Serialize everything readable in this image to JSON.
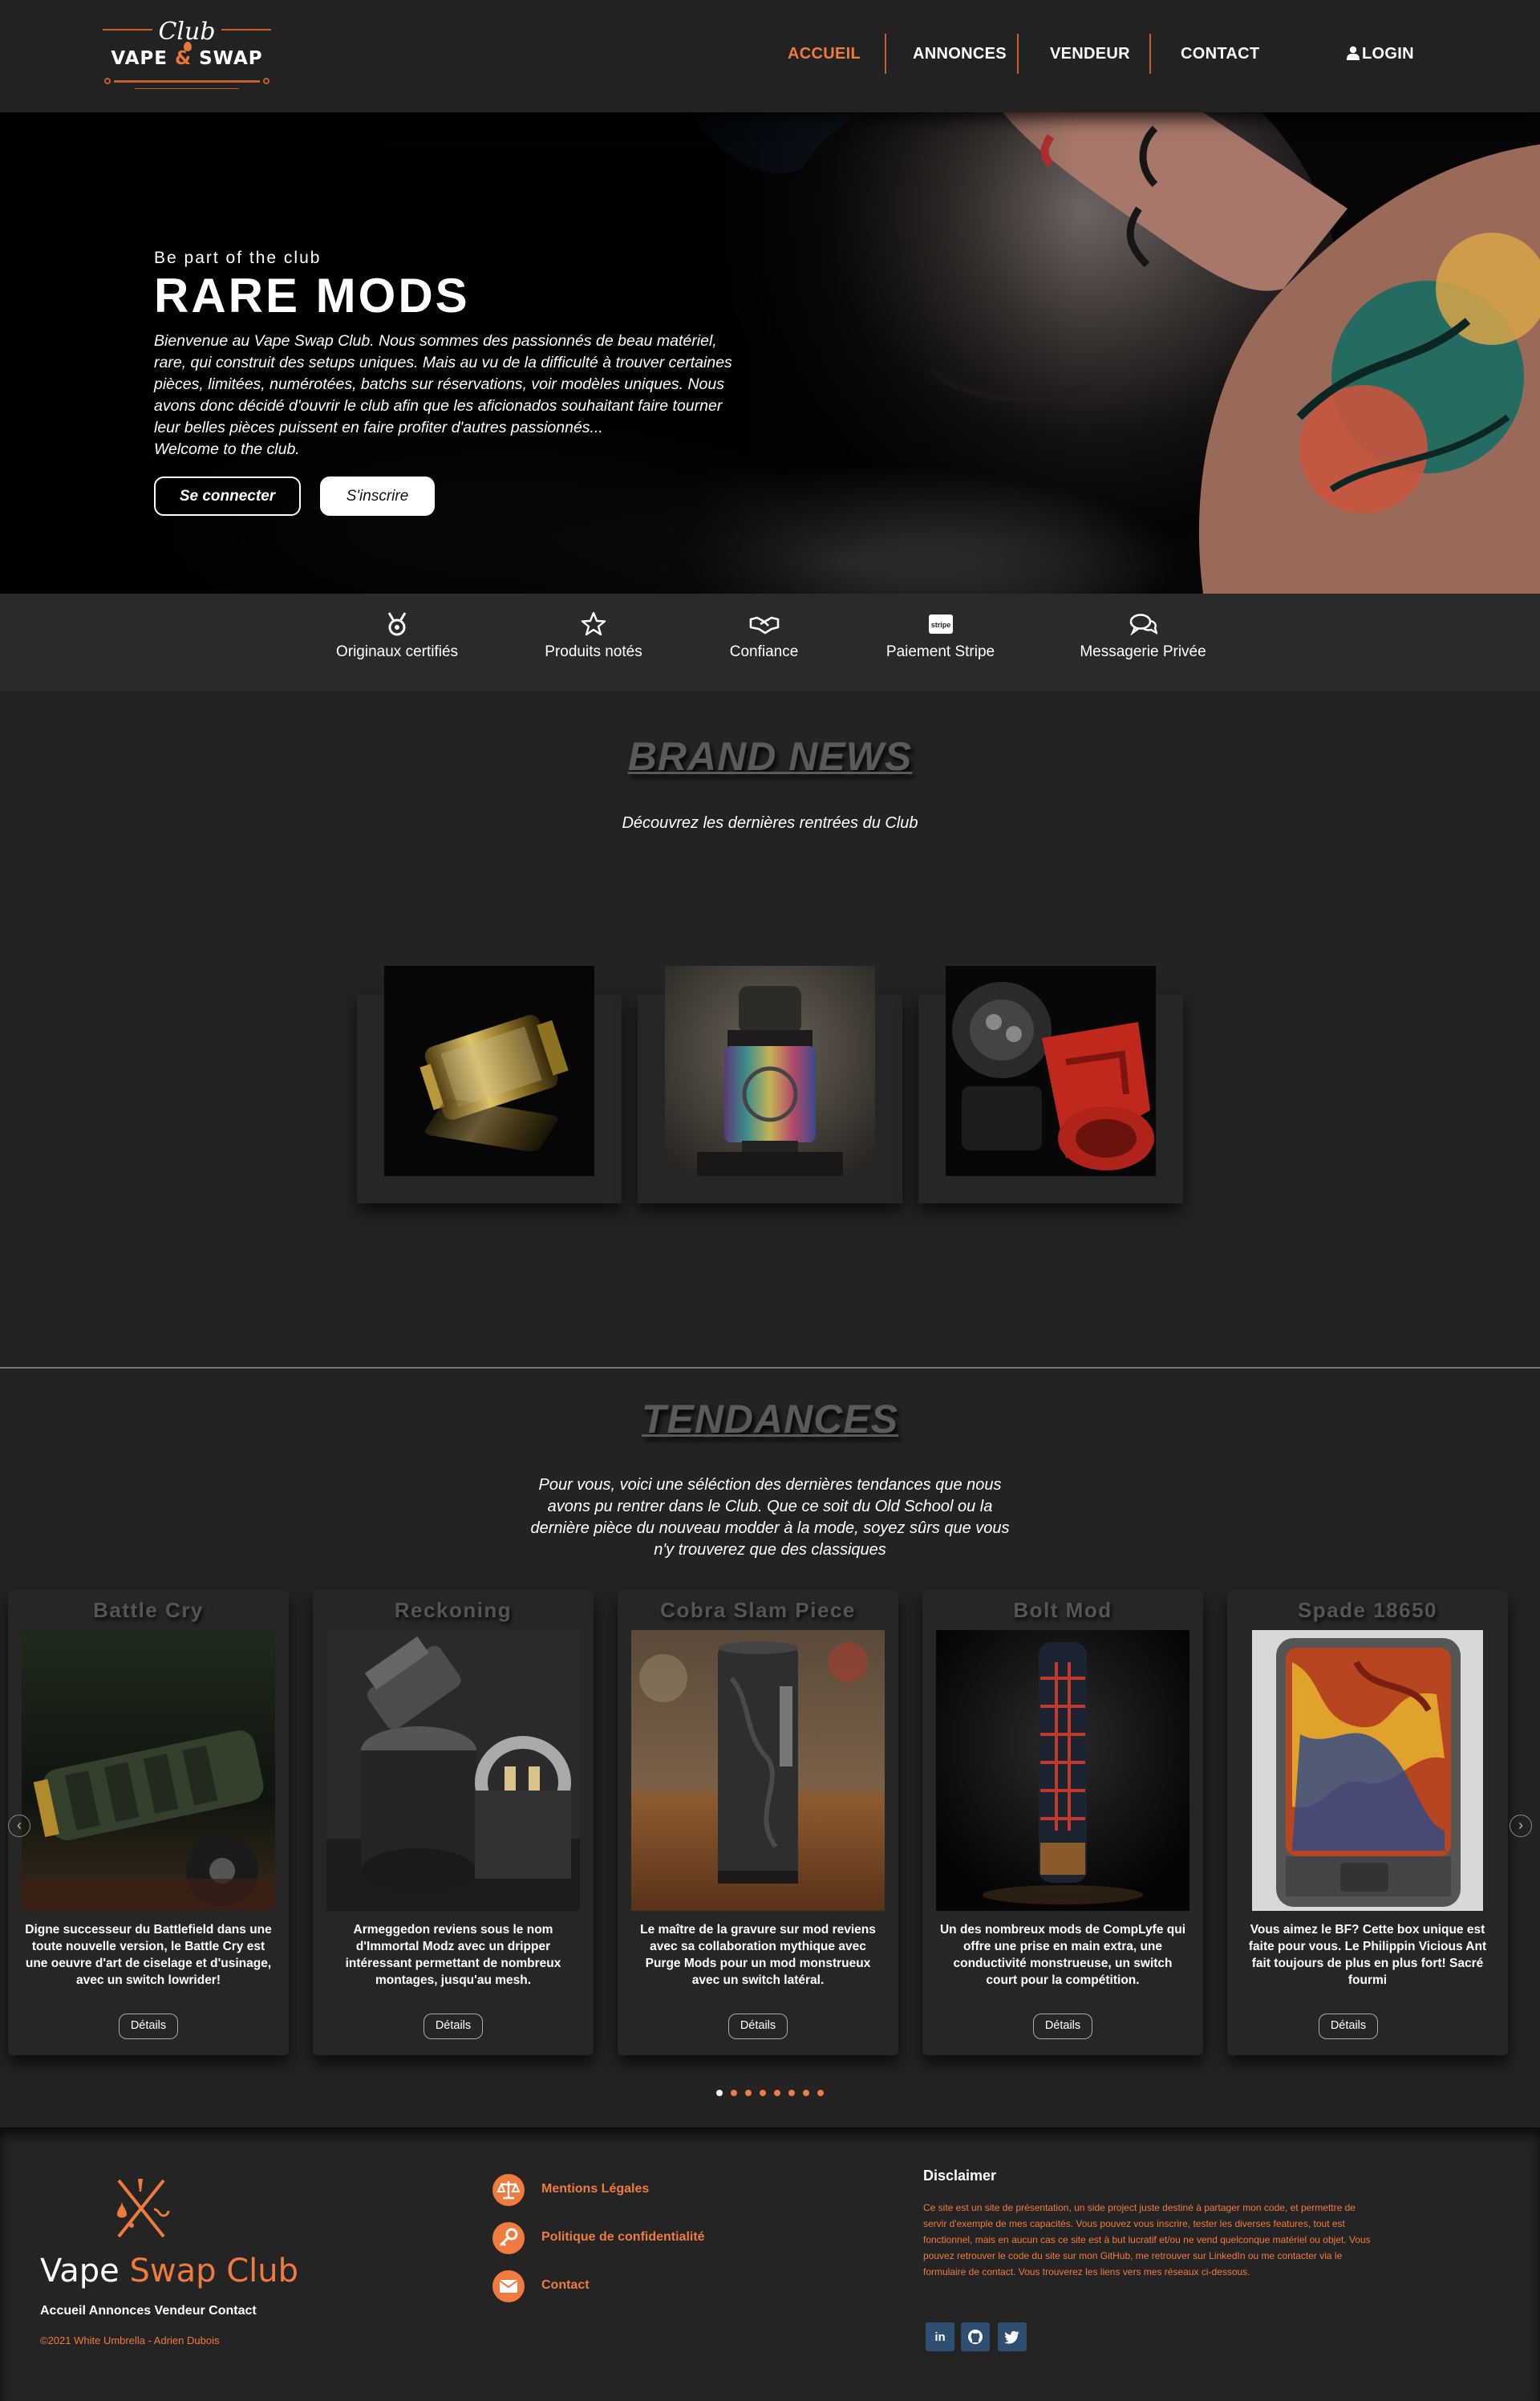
{
  "navbar": {
    "logo": {
      "club": "Club",
      "vape": "VAPE",
      "amp": "&",
      "swap": "SWAP"
    },
    "items": [
      {
        "label": "ACCUEIL",
        "active": true
      },
      {
        "label": "ANNONCES",
        "active": false
      },
      {
        "label": "VENDEUR",
        "active": false
      },
      {
        "label": "CONTACT",
        "active": false
      }
    ],
    "login": "LOGIN",
    "accent": "#f07b3f"
  },
  "hero": {
    "kicker": "Be part of the club",
    "title": "RARE MODS",
    "lines": [
      "Bienvenue au Vape Swap Club. Nous sommes des passionnés de beau matériel,",
      "rare, qui construit des setups uniques. Mais au vu de la difficulté à trouver certaines",
      "pièces, limitées, numérotées, batchs sur réservations, voir modèles uniques. Nous",
      "avons donc décidé d'ouvrir le club afin que les aficionados souhaitant faire tourner",
      "leur belles pièces puissent en faire profiter d'autres passionnés...",
      "Welcome to the club."
    ],
    "btn_login": "Se connecter",
    "btn_signup": "S'inscrire"
  },
  "features": [
    {
      "label": "Originaux certifiés",
      "icon": "medal-icon"
    },
    {
      "label": "Produits notés",
      "icon": "star-icon"
    },
    {
      "label": "Confiance",
      "icon": "handshake-icon"
    },
    {
      "label": "Paiement Stripe",
      "icon": "stripe-icon",
      "icon_text": "stripe"
    },
    {
      "label": "Messagerie Privée",
      "icon": "chat-icon"
    }
  ],
  "brand_news": {
    "title": "BRAND NEWS",
    "subtitle": "Découvrez les dernières rentrées du Club"
  },
  "tendances": {
    "title": "TENDANCES",
    "subtitle_lines": [
      "Pour vous, voici une séléction des dernières tendances que nous",
      "avons pu rentrer dans le Club. Que ce soit du Old School ou la",
      "dernière pièce du nouveau modder à la mode, soyez sûrs que vous",
      "n'y trouverez que des classiques"
    ],
    "cards": [
      {
        "title": "Battle Cry",
        "desc": "Digne successeur du Battlefield dans une toute nouvelle version, le Battle Cry est une oeuvre d'art de ciselage et d'usinage, avec un switch lowrider!",
        "button": "Détails"
      },
      {
        "title": "Reckoning",
        "desc": "Armeggedon reviens sous le nom d'Immortal Modz avec un dripper intéressant permettant de nombreux montages, jusqu'au mesh.",
        "button": "Détails"
      },
      {
        "title": "Cobra Slam Piece",
        "desc": "Le maître de la gravure sur mod reviens avec sa collaboration mythique avec Purge Mods pour un mod monstrueux avec un switch latéral.",
        "button": "Détails"
      },
      {
        "title": "Bolt Mod",
        "desc": "Un des nombreux mods de CompLyfe qui offre une prise en main extra, une conductivité monstrueuse, un switch court pour la compétition.",
        "button": "Détails"
      },
      {
        "title": "Spade 18650",
        "desc": "Vous aimez le BF? Cette box unique est faite pour vous. Le Philippin Vicious Ant fait toujours de plus en plus fort! Sacré fourmi",
        "button": "Détails"
      }
    ],
    "carousel": {
      "prev": "‹",
      "next": "›",
      "dot_count": 8,
      "active_dot": 0
    }
  },
  "footer": {
    "brand_white": "Vape ",
    "brand_orange": "Swap Club",
    "links": "Accueil Annonces Vendeur Contact",
    "copyright": "©2021 White Umbrella - Adrien Dubois",
    "items": [
      {
        "label": "Mentions Légales",
        "icon": "balance-scale-icon"
      },
      {
        "label": "Politique de confidentialité",
        "icon": "key-icon"
      },
      {
        "label": "Contact",
        "icon": "envelope-icon"
      }
    ],
    "disclaimer_title": "Disclaimer",
    "disclaimer": "Ce site est un site de présentation, un side project juste destiné à partager mon code, et permettre de servir d'exemple de mes capacités. Vous pouvez vous inscrire, tester les diverses features, tout est fonctionnel, mais en aucun cas ce site est à but lucratif et/ou ne vend quelconque matériel ou objet. Vous pouvez retrouver le code du site sur mon GitHub, me retrouver sur LinkedIn ou me contacter via le formulaire de contact. Vous trouverez les liens vers mes réseaux ci-dessous.",
    "socials": [
      {
        "name": "linkedin",
        "text": "in"
      },
      {
        "name": "github"
      },
      {
        "name": "twitter"
      }
    ]
  }
}
